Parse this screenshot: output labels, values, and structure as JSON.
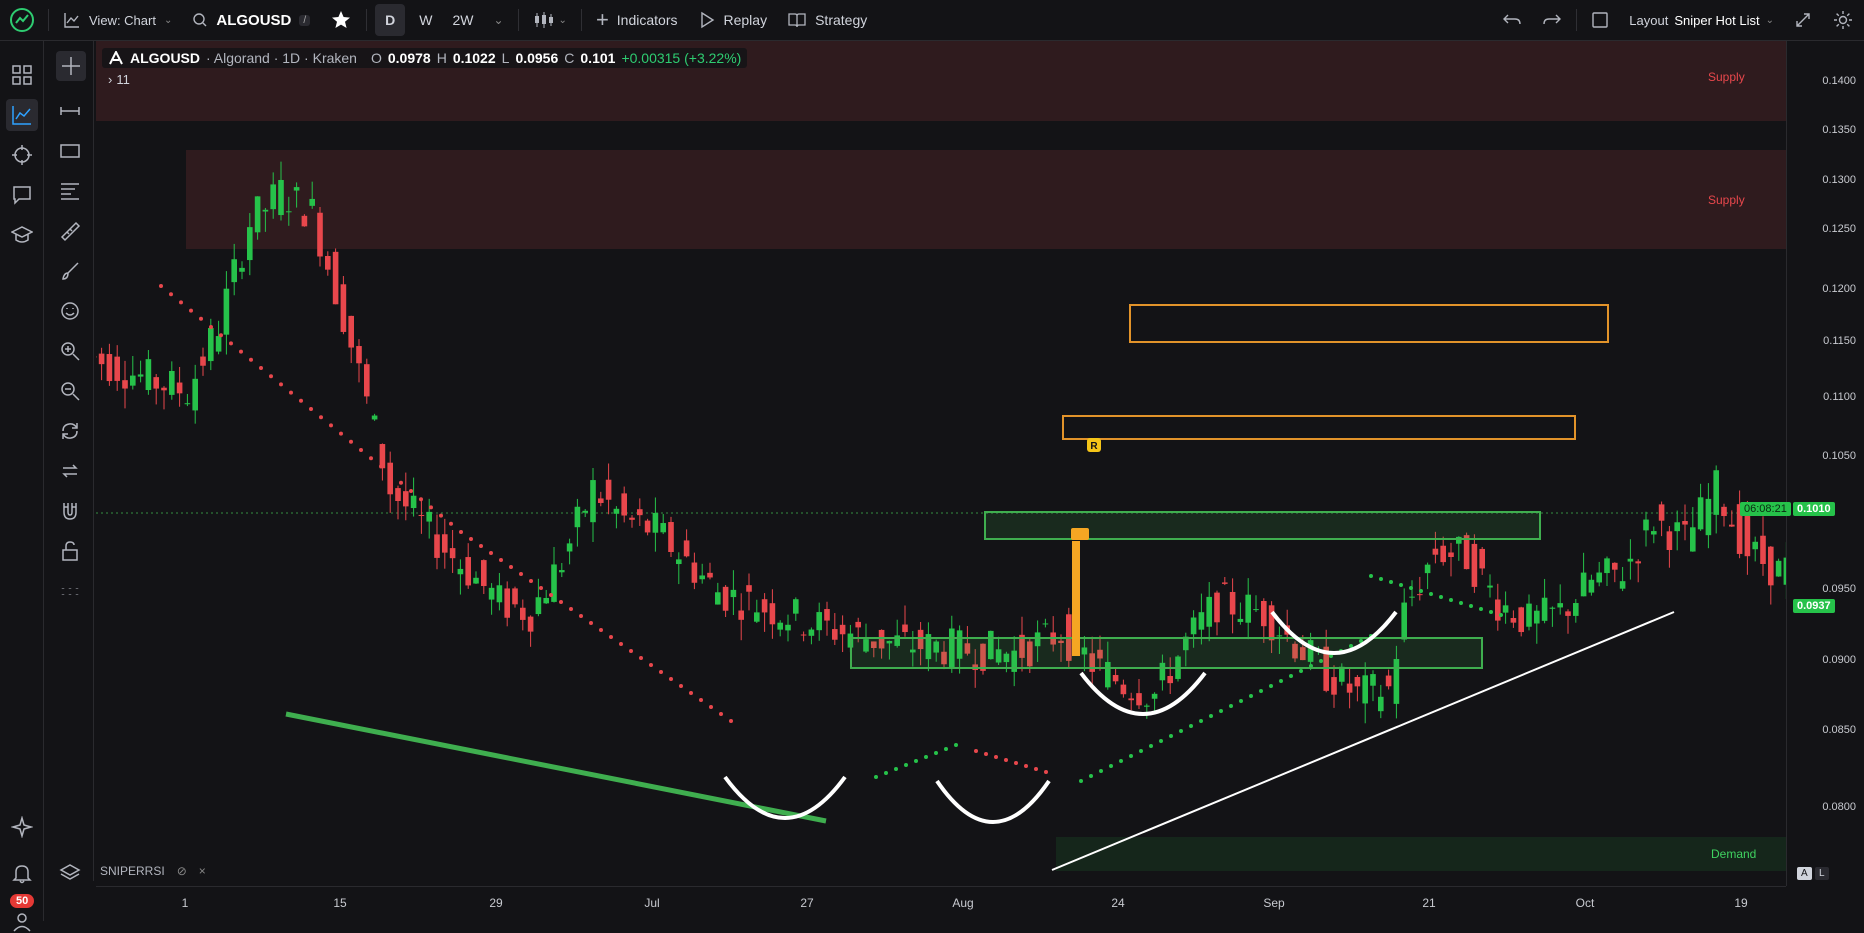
{
  "topbar": {
    "view_label": "View: Chart",
    "symbol": "ALGOUSD",
    "symbol_edit_marker": "/",
    "intervals": [
      "D",
      "W",
      "2W"
    ],
    "active_interval": "D",
    "indicators_label": "Indicators",
    "replay_label": "Replay",
    "strategy_label": "Strategy",
    "layout_prefix": "Layout",
    "layout_name": "Sniper Hot List"
  },
  "legend": {
    "symbol": "ALGOUSD",
    "description": "· Algorand · 1D · Kraken",
    "open_label": "O",
    "open": "0.0978",
    "high_label": "H",
    "high": "0.1022",
    "low_label": "L",
    "low": "0.0956",
    "close_label": "C",
    "close": "0.101",
    "change": "+0.00315 (+3.22%)",
    "collapsed_count": "11"
  },
  "indicator": {
    "name": "SNIPERRSI"
  },
  "notifications": {
    "count": "50"
  },
  "zones": {
    "supply_top": "Supply",
    "supply_mid": "Supply",
    "demand": "Demand"
  },
  "price_axis": {
    "ticks": [
      "0.1400",
      "0.1350",
      "0.1300",
      "0.1250",
      "0.1200",
      "0.1150",
      "0.1100",
      "0.1050",
      "0.0950",
      "0.0900",
      "0.0850",
      "0.0800"
    ],
    "current_price": "0.1010",
    "countdown": "06:08:21",
    "marker_price": "0.0937",
    "scale_buttons": [
      "A",
      "L"
    ]
  },
  "time_axis": {
    "ticks": [
      "1",
      "15",
      "29",
      "Jul",
      "27",
      "Aug",
      "24",
      "Sep",
      "21",
      "Oct",
      "19"
    ]
  },
  "markers": {
    "r_label": "R"
  },
  "colors": {
    "up": "#26c24a",
    "down": "#e8474c",
    "projection": "#6d6d72",
    "dots_bear": "#e8474c",
    "dots_bull": "#26c24a",
    "supply_zone": "#3a1f22",
    "demand_zone": "#16291c",
    "orange_box": "#e2932a",
    "green_box": "#3fae4f"
  }
}
